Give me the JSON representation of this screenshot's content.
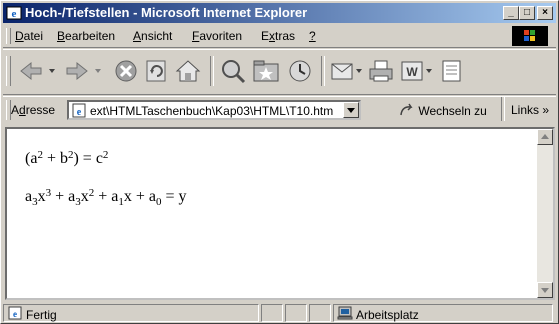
{
  "window": {
    "title": "Hoch-/Tiefstellen - Microsoft Internet Explorer",
    "minimize": "_",
    "maximize": "□",
    "close": "×"
  },
  "menu": {
    "datei": {
      "pre": "",
      "key": "D",
      "post": "atei"
    },
    "bearbeiten": {
      "pre": "",
      "key": "B",
      "post": "earbeiten"
    },
    "ansicht": {
      "pre": "",
      "key": "A",
      "post": "nsicht"
    },
    "favoriten": {
      "pre": "",
      "key": "F",
      "post": "avoriten"
    },
    "extras": {
      "pre": "E",
      "key": "x",
      "post": "tras"
    },
    "help": {
      "pre": "",
      "key": "?",
      "post": ""
    }
  },
  "toolbar": {
    "icons": [
      "back-icon",
      "forward-icon",
      "stop-icon",
      "refresh-icon",
      "home-icon",
      "search-icon",
      "favorites-icon",
      "history-icon",
      "mail-icon",
      "print-icon",
      "edit-icon",
      "discuss-icon"
    ]
  },
  "address": {
    "label_pre": "A",
    "label_key": "d",
    "label_post": "resse",
    "value": "ext\\HTMLTaschenbuch\\Kap03\\HTML\\T10.htm",
    "go_label": "Wechseln zu",
    "links_label": "Links »"
  },
  "content": {
    "line1": {
      "t1": "(a",
      "s1": "2",
      "t2": " + b",
      "s2": "2",
      "t3": ") = c",
      "s3": "2"
    },
    "line2": {
      "t1": "a",
      "b1": "3",
      "t2": "x",
      "p1": "3",
      "t3": " + a",
      "b2": "3",
      "t4": "x",
      "p2": "2",
      "t5": " + a",
      "b3": "1",
      "t6": "x + a",
      "b4": "0",
      "t7": " = y"
    }
  },
  "status": {
    "left": "Fertig",
    "zone": "Arbeitsplatz"
  },
  "colors": {
    "title_start": "#0a246a",
    "title_end": "#a6caf0",
    "chrome": "#d4d0c8"
  }
}
